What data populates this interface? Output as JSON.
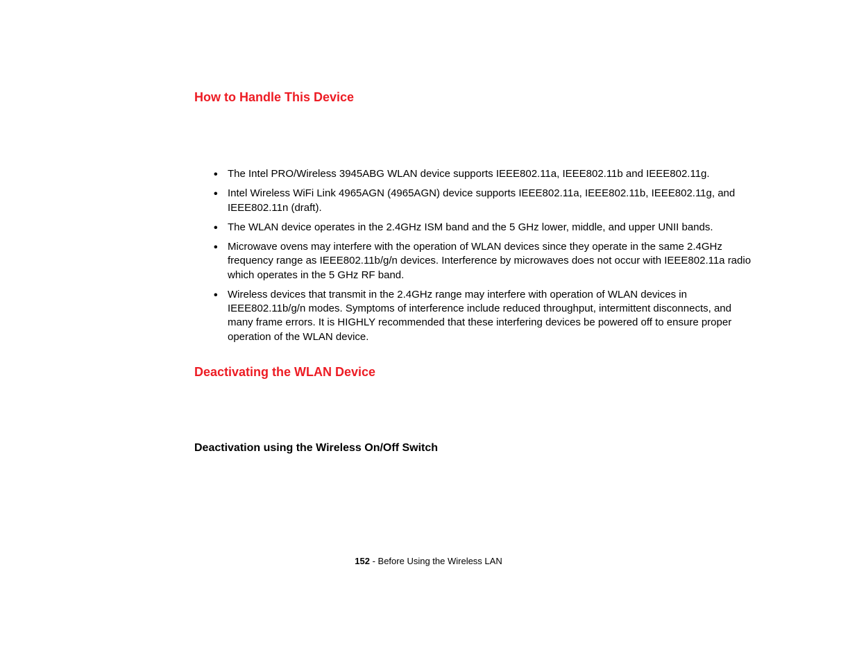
{
  "heading1": "How to Handle This Device",
  "bullets": {
    "item1": "The Intel PRO/Wireless 3945ABG WLAN device supports IEEE802.11a, IEEE802.11b and IEEE802.11g.",
    "item2": "Intel Wireless WiFi Link 4965AGN (4965AGN) device supports IEEE802.11a, IEEE802.11b, IEEE802.11g, and IEEE802.11n (draft).",
    "item3": "The WLAN device operates in the 2.4GHz ISM band and the 5 GHz lower, middle, and upper UNII bands.",
    "item4": "Microwave ovens may interfere with the operation of WLAN devices since they operate in the same 2.4GHz frequency range as IEEE802.11b/g/n devices. Interference by microwaves does not occur with IEEE802.11a radio which operates in the 5 GHz RF band.",
    "item5": "Wireless devices that transmit in the 2.4GHz range may interfere with operation of WLAN devices in IEEE802.11b/g/n modes. Symptoms of interference include reduced throughput, intermittent disconnects, and many frame errors. It is HIGHLY recommended that these interfering devices be powered off to ensure proper operation of the WLAN device."
  },
  "heading2": "Deactivating the WLAN Device",
  "subheading": "Deactivation using the Wireless On/Off Switch",
  "footer": {
    "page_num": "152",
    "separator": " - ",
    "section": "Before Using the Wireless LAN"
  }
}
